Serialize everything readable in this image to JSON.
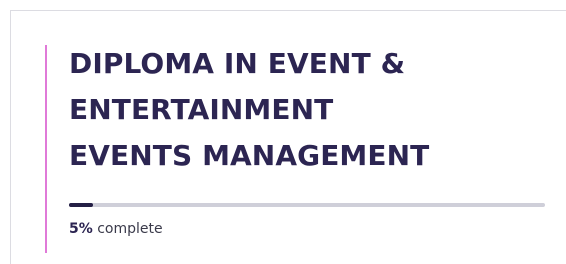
{
  "course": {
    "title_lines": [
      "DIPLOMA IN EVENT &",
      "ENTERTAINMENT",
      "EVENTS MANAGEMENT"
    ]
  },
  "progress": {
    "percent": 5,
    "percent_label": "5%",
    "suffix": "complete"
  },
  "colors": {
    "accent": "#e07ad8",
    "title": "#2c2552",
    "track": "#cfcfd9",
    "fill": "#241f45"
  }
}
